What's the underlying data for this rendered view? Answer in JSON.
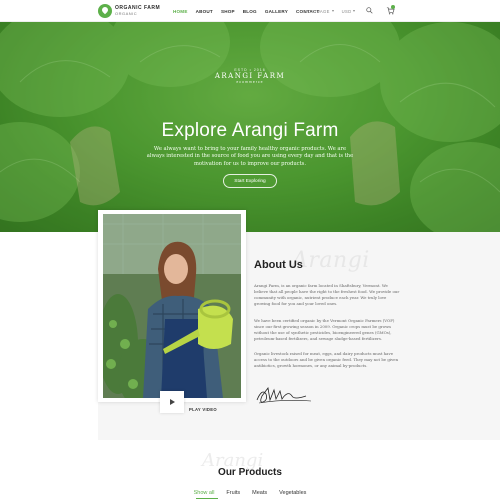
{
  "logo": {
    "line1": "ORGANIC FARM",
    "line2": "ORGANIC"
  },
  "nav": {
    "items": [
      {
        "label": "HOME",
        "active": true
      },
      {
        "label": "ABOUT",
        "active": false
      },
      {
        "label": "SHOP",
        "active": false
      },
      {
        "label": "BLOG",
        "active": false
      },
      {
        "label": "GALLERY",
        "active": false
      },
      {
        "label": "CONTACT",
        "active": false
      }
    ]
  },
  "selects": {
    "language": "LANGUAGE",
    "currency": "USD"
  },
  "icons": {
    "search": "search-icon",
    "cart": "cart-icon",
    "play": "play-icon"
  },
  "hero": {
    "est": "ESTD • 2016",
    "brand": "ARANGI FARM",
    "brand_sub": "ecommerce",
    "title": "Explore Arangi Farm",
    "text": "We always want to bring to your family healthy organic products. We are always interested in the source of food you are using every day and that is the motivation for us to improve our products.",
    "button": "Start Exploring"
  },
  "about": {
    "watermark": "Arangi",
    "title": "About Us",
    "paragraphs": [
      "Arangi Farm, is an organic farm located in Shaftsbury, Vermont. We believe that all people have the right to the freshest food. We provide our community with organic, nutrient produce each year. We truly love growing food for you and your loved ones.",
      "We have been certified organic by the Vermont Organic Farmers (VOF) since our first growing season in 2009. Organic crops must be grown without the use of synthetic pesticides, bioengineered genes (GMOs), petroleum-based fertilizers, and sewage sludge-based fertilizers.",
      "Organic livestock raised for meat, eggs, and dairy products must have access to the outdoors and be given organic feed. They may not be given antibiotics, growth hormones, or any animal by-products."
    ],
    "play_label": "PLAY VIDEO"
  },
  "products": {
    "watermark": "Arangi",
    "title": "Our Products",
    "filters": [
      {
        "label": "Show all",
        "active": true
      },
      {
        "label": "Fruits",
        "active": false
      },
      {
        "label": "Meats",
        "active": false
      },
      {
        "label": "Vegetables",
        "active": false
      }
    ]
  },
  "colors": {
    "accent": "#5db04a",
    "hero_green": "#4f9a32",
    "section_bg": "#f6f6f6"
  }
}
